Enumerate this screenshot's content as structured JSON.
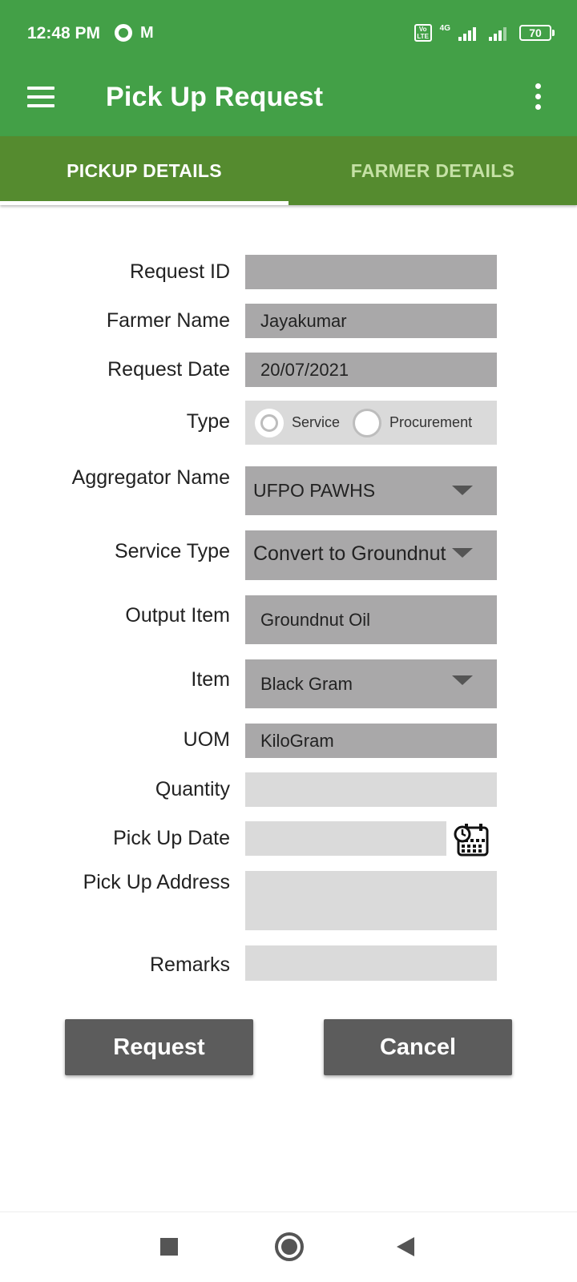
{
  "status_bar": {
    "time": "12:48 PM",
    "left_icons": [
      "ring-icon",
      "gmail-icon"
    ],
    "mail_glyph": "M",
    "volte": "Vo LTE",
    "network": "4G",
    "battery": "70"
  },
  "app_bar": {
    "title": "Pick Up Request",
    "menu_icon": "hamburger-menu-icon",
    "overflow_icon": "more-vert-icon"
  },
  "tabs": [
    {
      "label": "PICKUP DETAILS",
      "active": true
    },
    {
      "label": "FARMER DETAILS",
      "active": false
    }
  ],
  "form": {
    "request_id": {
      "label": "Request ID",
      "value": ""
    },
    "farmer_name": {
      "label": "Farmer Name",
      "value": "Jayakumar"
    },
    "request_date": {
      "label": "Request Date",
      "value": "20/07/2021"
    },
    "type": {
      "label": "Type",
      "options": [
        "Service",
        "Procurement"
      ],
      "selected": "Service"
    },
    "aggregator_name": {
      "label": "Aggregator Name",
      "value": "UFPO PAWHS"
    },
    "service_type": {
      "label": "Service Type",
      "value": "Convert to Groundnut"
    },
    "output_item": {
      "label": "Output Item",
      "value": "Groundnut Oil"
    },
    "item": {
      "label": "Item",
      "value": "Black Gram"
    },
    "uom": {
      "label": "UOM",
      "value": "KiloGram"
    },
    "quantity": {
      "label": "Quantity",
      "value": ""
    },
    "pick_up_date": {
      "label": "Pick Up Date",
      "value": "",
      "icon": "calendar-clock-icon"
    },
    "pick_up_address": {
      "label": "Pick Up Address",
      "value": ""
    },
    "remarks": {
      "label": "Remarks",
      "value": ""
    }
  },
  "buttons": {
    "request": "Request",
    "cancel": "Cancel"
  },
  "colors": {
    "primary": "#43a047",
    "tab_bar": "#558b2f",
    "field_dark": "#a9a8a9",
    "field_light": "#dadada",
    "button": "#5c5c5c"
  }
}
